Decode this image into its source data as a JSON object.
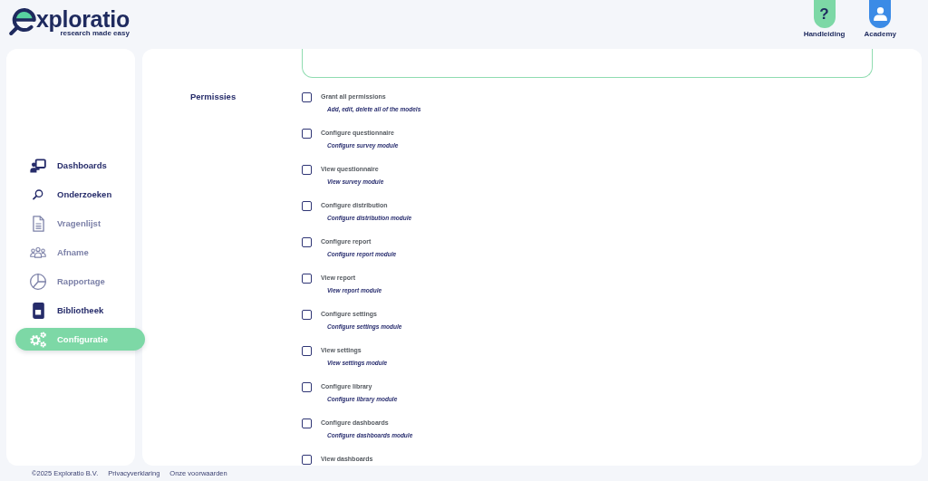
{
  "header": {
    "logo": {
      "wordmark": "xploratio",
      "tagline": "research made easy"
    },
    "links": [
      {
        "label": "Handleiding",
        "glyph": "?",
        "color": "#7dd8a6"
      },
      {
        "label": "Academy",
        "color": "#3b8be6"
      }
    ]
  },
  "sidebar": {
    "items": [
      {
        "label": "Dashboards",
        "selected": false,
        "disabled": false
      },
      {
        "label": "Onderzoeken",
        "selected": false,
        "disabled": false
      },
      {
        "label": "Vragenlijst",
        "selected": false,
        "disabled": true
      },
      {
        "label": "Afname",
        "selected": false,
        "disabled": true
      },
      {
        "label": "Rapportage",
        "selected": false,
        "disabled": true
      },
      {
        "label": "Bibliotheek",
        "selected": false,
        "disabled": false
      },
      {
        "label": "Configuratie",
        "selected": true,
        "disabled": false
      }
    ]
  },
  "permissions": {
    "label": "Permissies",
    "items": [
      {
        "title": "Grant all permissions",
        "description": "Add, edit, delete all of the models",
        "checked": false
      },
      {
        "title": "Configure questionnaire",
        "description": "Configure survey module",
        "checked": false
      },
      {
        "title": "View questionnaire",
        "description": "View survey module",
        "checked": false
      },
      {
        "title": "Configure distribution",
        "description": "Configure distribution module",
        "checked": false
      },
      {
        "title": "Configure report",
        "description": "Configure report module",
        "checked": false
      },
      {
        "title": "View report",
        "description": "View report module",
        "checked": false
      },
      {
        "title": "Configure settings",
        "description": "Configure settings module",
        "checked": false
      },
      {
        "title": "View settings",
        "description": "View settings module",
        "checked": false
      },
      {
        "title": "Configure library",
        "description": "Configure library module",
        "checked": false
      },
      {
        "title": "Configure dashboards",
        "description": "Configure dashboards module",
        "checked": false
      },
      {
        "title": "View dashboards",
        "checked": false
      }
    ]
  },
  "footer": {
    "copyright": "©2025 Exploratio B.V.",
    "links": [
      "Privacyverklaring",
      "Onze voorwaarden"
    ]
  }
}
